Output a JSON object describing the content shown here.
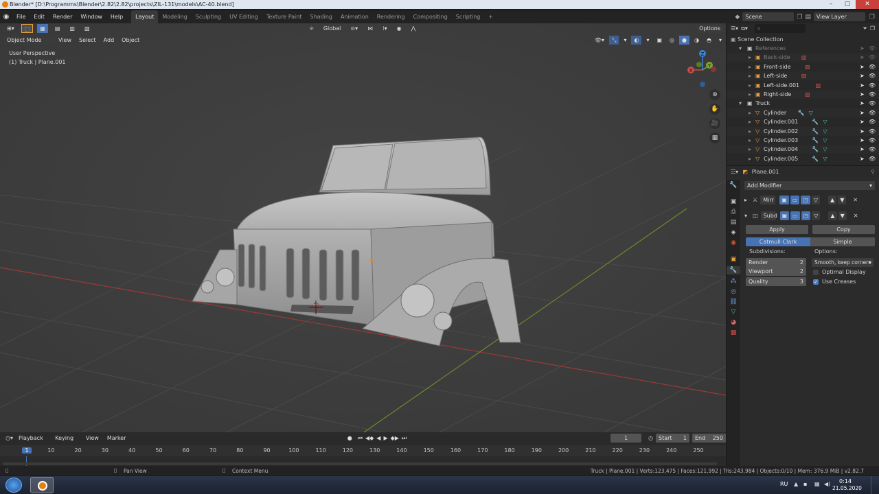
{
  "window": {
    "title": "Blender* [D:\\Programms\\Blender\\2.82\\2.82\\projects\\ZIL-131\\models\\AC-40.blend]",
    "controls": [
      "–",
      "▢",
      "✕"
    ]
  },
  "menu": [
    "File",
    "Edit",
    "Render",
    "Window",
    "Help"
  ],
  "workspaces": [
    "Layout",
    "Modeling",
    "Sculpting",
    "UV Editing",
    "Texture Paint",
    "Shading",
    "Animation",
    "Rendering",
    "Compositing",
    "Scripting"
  ],
  "workspace_add": "+",
  "scene": {
    "label": "Scene",
    "view_layer": "View Layer"
  },
  "viewport": {
    "transform_orientation": "Global",
    "options_label": "Options",
    "mode": "Object Mode",
    "header_menus": [
      "View",
      "Select",
      "Add",
      "Object"
    ],
    "overlay_line1": "User Perspective",
    "overlay_line2": "(1) Truck | Plane.001",
    "gizmo": {
      "x": "X",
      "y": "Y",
      "z": "Z"
    }
  },
  "outliner": {
    "search_placeholder": "",
    "root": "Scene Collection",
    "rows": [
      {
        "label": "References",
        "indent": 1,
        "type": "collection",
        "dim": true
      },
      {
        "label": "Back-side",
        "indent": 2,
        "type": "image",
        "dim": true
      },
      {
        "label": "Front-side",
        "indent": 2,
        "type": "image",
        "dim": false
      },
      {
        "label": "Left-side",
        "indent": 2,
        "type": "image",
        "dim": false
      },
      {
        "label": "Left-side.001",
        "indent": 2,
        "type": "image",
        "dim": false
      },
      {
        "label": "Right-side",
        "indent": 2,
        "type": "image",
        "dim": false
      },
      {
        "label": "Truck",
        "indent": 1,
        "type": "collection",
        "dim": false
      },
      {
        "label": "Cylinder",
        "indent": 2,
        "type": "mesh",
        "dim": false
      },
      {
        "label": "Cylinder.001",
        "indent": 2,
        "type": "mesh",
        "dim": false
      },
      {
        "label": "Cylinder.002",
        "indent": 2,
        "type": "mesh",
        "dim": false
      },
      {
        "label": "Cylinder.003",
        "indent": 2,
        "type": "mesh",
        "dim": false
      },
      {
        "label": "Cylinder.004",
        "indent": 2,
        "type": "mesh",
        "dim": false
      },
      {
        "label": "Cylinder.005",
        "indent": 2,
        "type": "mesh",
        "dim": false
      }
    ]
  },
  "properties": {
    "object_name": "Plane.001",
    "add_modifier": "Add Modifier",
    "modifiers": [
      {
        "name": "Mirr",
        "expanded": false
      },
      {
        "name": "Subd",
        "expanded": true
      }
    ],
    "apply": "Apply",
    "copy": "Copy",
    "algorithms": [
      "Catmull-Clark",
      "Simple"
    ],
    "subdivisions_label": "Subdivisions:",
    "options_label": "Options:",
    "render_label": "Render",
    "render_value": "2",
    "viewport_label": "Viewport",
    "viewport_value": "2",
    "quality_label": "Quality",
    "quality_value": "3",
    "uv_smooth": "Smooth, keep corners",
    "optimal_display": "Optimal Display",
    "optimal_display_checked": false,
    "use_creases": "Use Creases",
    "use_creases_checked": true
  },
  "timeline": {
    "menus": [
      "Playback",
      "Keying",
      "View",
      "Marker"
    ],
    "current_frame": "1",
    "start_label": "Start",
    "start": "1",
    "end_label": "End",
    "end": "250",
    "ticks": [
      "1",
      "10",
      "20",
      "30",
      "40",
      "50",
      "60",
      "70",
      "80",
      "90",
      "100",
      "110",
      "120",
      "130",
      "140",
      "150",
      "160",
      "170",
      "180",
      "190",
      "200",
      "210",
      "220",
      "230",
      "240",
      "250"
    ]
  },
  "status": {
    "left_hint": "Pan View",
    "mid_hint": "Context Menu",
    "stats": "Truck | Plane.001 | Verts:123,475 | Faces:121,992 | Tris:243,984 | Objects:0/10 | Mem: 376.9 MiB | v2.82.7"
  },
  "taskbar": {
    "lang": "RU",
    "time": "0:14",
    "date": "21.05.2020"
  },
  "colors": {
    "accent": "#4772b3",
    "viewport_bg": "#3d3d3d",
    "panel_bg": "#2b2b2b",
    "x_axis": "#c84c4c",
    "y_axis": "#7ca22f",
    "z_axis": "#3b83d6"
  }
}
